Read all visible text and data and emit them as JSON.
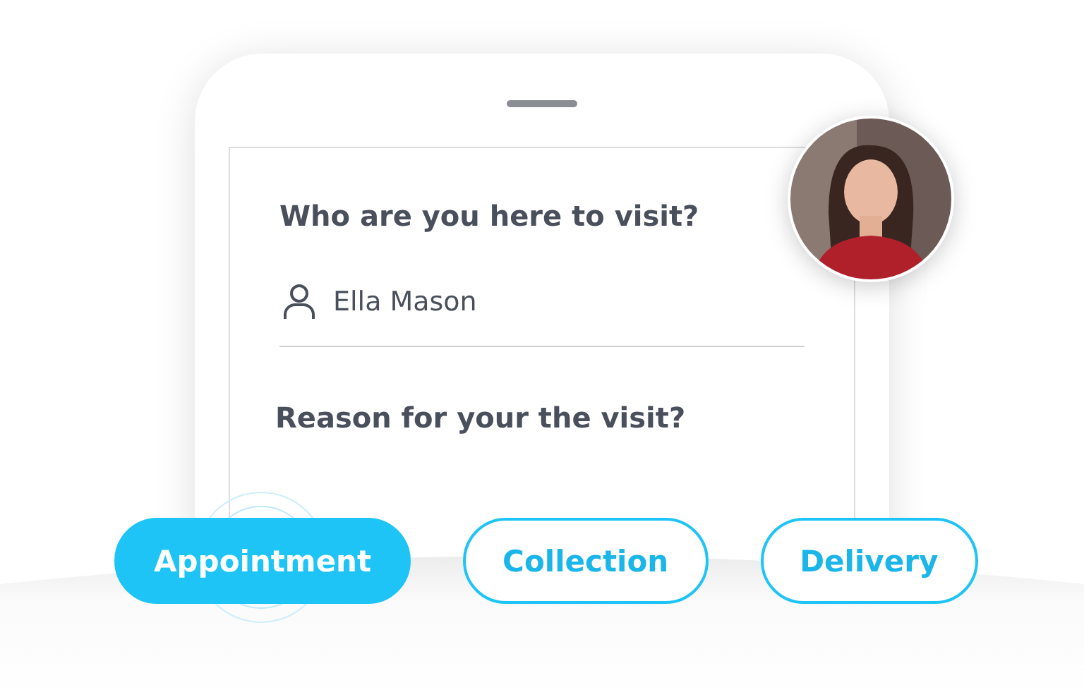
{
  "form": {
    "visit_question": "Who are you here to visit?",
    "host": {
      "value": "Ella Mason"
    },
    "reason_question": "Reason for your the visit?"
  },
  "reasons": [
    {
      "label": "Appointment",
      "selected": true
    },
    {
      "label": "Collection",
      "selected": false
    },
    {
      "label": "Delivery",
      "selected": false
    }
  ]
}
